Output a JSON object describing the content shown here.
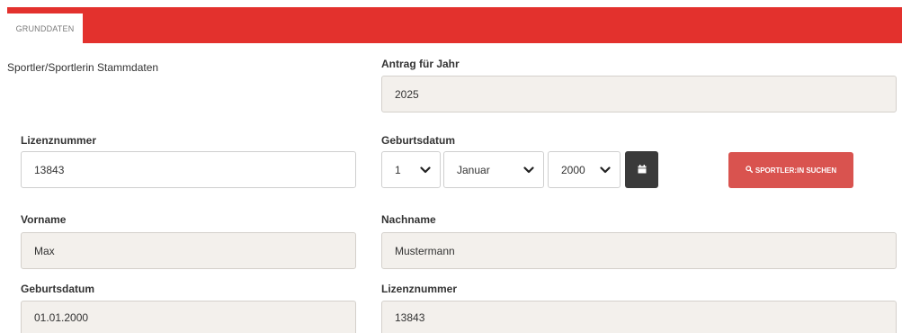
{
  "tabs": [
    {
      "label": "GRUNDDATEN"
    }
  ],
  "section_title": "Sportler/Sportlerin Stammdaten",
  "antrag": {
    "label": "Antrag für Jahr",
    "value": "2025"
  },
  "lizenz_input": {
    "label": "Lizenznummer",
    "value": "13843"
  },
  "geburtsdatum_select": {
    "label": "Geburtsdatum",
    "day": "1",
    "month": "Januar",
    "year": "2000"
  },
  "search_button": {
    "label": "SPORTLER:IN SUCHEN"
  },
  "vorname": {
    "label": "Vorname",
    "value": "Max"
  },
  "nachname": {
    "label": "Nachname",
    "value": "Mustermann"
  },
  "geburtsdatum_display": {
    "label": "Geburtsdatum",
    "value": "01.01.2000"
  },
  "lizenz_display": {
    "label": "Lizenznummer",
    "value": "13843"
  },
  "colors": {
    "brand_red": "#e3312d",
    "button_red": "#d9534f",
    "readonly_bg": "#f3f0ec",
    "dark_button": "#3a3a3a"
  }
}
